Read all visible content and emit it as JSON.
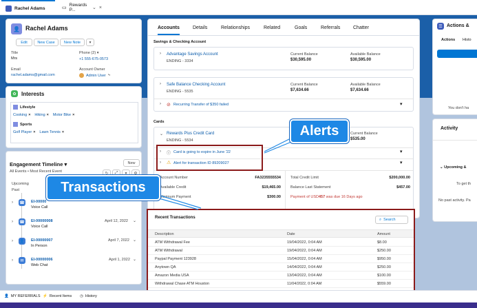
{
  "tabs": [
    {
      "label": "Rachel Adams"
    },
    {
      "label": "Rewards P..."
    }
  ],
  "profile": {
    "name": "Rachel Adams",
    "buttons": [
      "Edit",
      "New Case",
      "New Note"
    ],
    "title_label": "Title",
    "title_value": "Mrs",
    "phone_label": "Phone (2)",
    "phone_value": "+1 555-675-0573",
    "email_label": "Email",
    "email_value": "rachel.adams@gmail.com",
    "owner_label": "Account Owner",
    "owner_value": "Admin User"
  },
  "interests": {
    "title": "Interests",
    "lifestyle_label": "Lifestyle",
    "lifestyle_items": [
      "Cooking",
      "Hiking",
      "Motor Bike"
    ],
    "sports_label": "Sports",
    "sports_items": [
      "Golf Player",
      "Lawn Tennis"
    ]
  },
  "timeline": {
    "title": "Engagement Timeline",
    "new_label": "New",
    "filter": "All Events • Most Recent Event",
    "upcoming": "Upcoming",
    "past": "Past",
    "events": [
      {
        "id": "EI-00000",
        "type": "Voice Call",
        "date": ""
      },
      {
        "id": "EI-00000008",
        "type": "Voice Call",
        "date": "April 12, 2022"
      },
      {
        "id": "EI-00000007",
        "type": "In Person",
        "date": "April 7, 2022"
      },
      {
        "id": "EI-00000006",
        "type": "Web Chat",
        "date": "April 1, 2022"
      }
    ]
  },
  "main": {
    "tabs": [
      "Accounts",
      "Details",
      "Relationships",
      "Related",
      "Goals",
      "Referrals",
      "Chatter"
    ],
    "savings_title": "Savings & Checking Account",
    "accounts": [
      {
        "name": "Advantage Savings Account",
        "ending": "ENDING - 3334",
        "cb_label": "Current Balance",
        "cb": "$30,595.00",
        "ab_label": "Available Balance",
        "ab": "$30,595.00"
      },
      {
        "name": "Safe Balance Checking Account",
        "ending": "ENDING - 5535",
        "cb_label": "Current Balance",
        "cb": "$7,634.66",
        "ab_label": "Available Balance",
        "ab": "$7,634.66"
      }
    ],
    "recurring": "Recurring Transfer of $350 failed",
    "cards_title": "Cards",
    "card": {
      "name": "Rewards Plus Credit Card",
      "ending": "ENDING - 5534",
      "cb_label": "Current Balance",
      "cb": "$535.00"
    },
    "alerts": [
      "Card is going to expire in June '22",
      "Alert for transaction ID 89209027"
    ],
    "details": {
      "acct_label": "Account Number",
      "acct": "FA3235555534",
      "avail_label": "Available Credit",
      "avail": "$19,465.00",
      "min_label": "Minimum Payment",
      "min": "$300.00",
      "limit_label": "Total Credit Limit",
      "limit": "$200,000.00",
      "last_label": "Balance Last Statement",
      "last": "$457.00",
      "warning_prefix": "Payment of USD",
      "warning_amount": "457",
      "warning_suffix": " was due 16 Days ago"
    }
  },
  "transactions": {
    "title": "Recent Transactions",
    "search_label": "Search",
    "headers": [
      "Description",
      "Date",
      "Amount"
    ],
    "rows": [
      [
        "ATM Withdrawal Fee",
        "19/04/2022, 0:04 AM",
        "$8.00"
      ],
      [
        "ATM Withdrawal",
        "19/04/2022, 0:04 AM",
        "$250.00"
      ],
      [
        "Paypal Payment 123928",
        "15/04/2022, 0:04 AM",
        "$950.00"
      ],
      [
        "Anytown QA",
        "14/04/2022, 0:04 AM",
        "$250.00"
      ],
      [
        "Amazon Media USA",
        "13/04/2022, 0:04 AM",
        "$100.00"
      ],
      [
        "Withdrawal Chase ATM Houston",
        "11/04/2022, 0:04 AM",
        "$559.00"
      ]
    ]
  },
  "actions": {
    "title": "Actions &",
    "tab1": "Actions",
    "tab2": "Histo",
    "empty": "You don't ha"
  },
  "activity": {
    "title": "Activity",
    "upcoming": "Upcoming &",
    "get": "To get th",
    "no_past": "No past activity. Pa"
  },
  "annotations": {
    "alerts": "Alerts",
    "transactions": "Transactions"
  },
  "footer": {
    "items": [
      "MY REFERRALS",
      "Recent Items",
      "History"
    ]
  }
}
